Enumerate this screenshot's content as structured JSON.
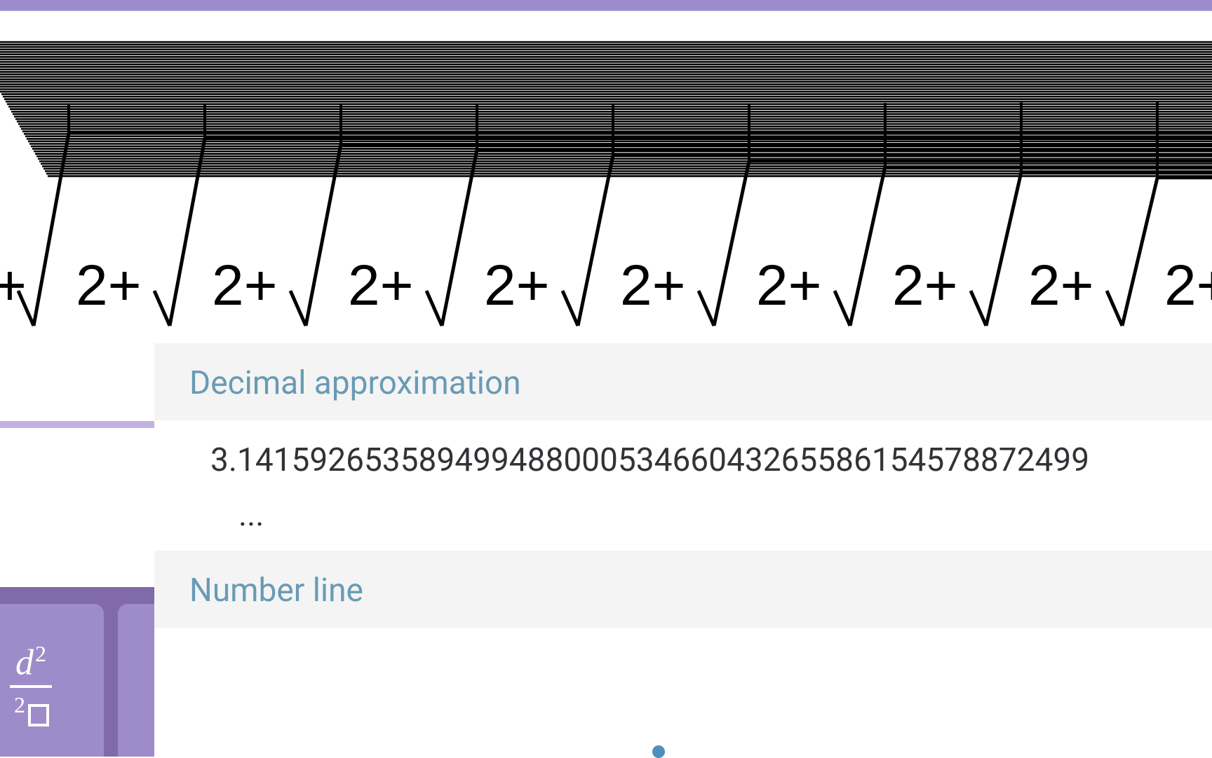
{
  "app": {
    "accent": "#9d8ccd"
  },
  "expression": {
    "depth": 18,
    "term_text": "2+",
    "leading_plus": "+"
  },
  "results": {
    "decimal_label": "Decimal approximation",
    "decimal_value": "3.14159265358949948800053466043265586154578872499",
    "ellipsis": "...",
    "number_line_label": "Number line"
  },
  "keypad": {
    "d2_over_2box": {
      "num": "d",
      "num_sup": "2",
      "den_sup": "2"
    }
  }
}
